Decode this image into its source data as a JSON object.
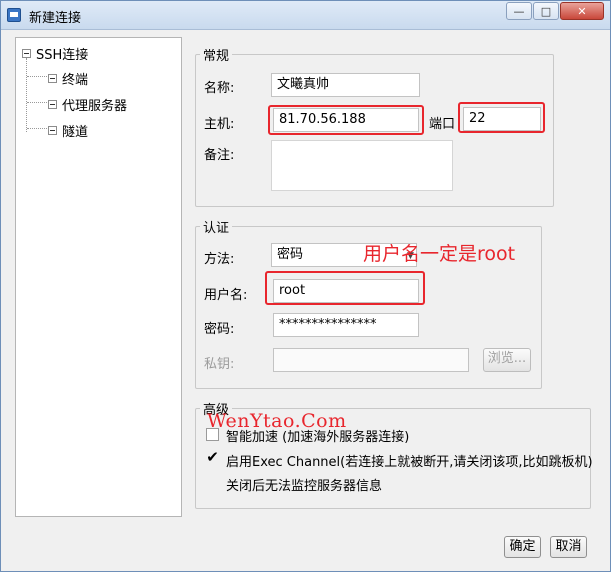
{
  "window": {
    "title": "新建连接",
    "minimize": "—",
    "maximize": "□",
    "close": "✕"
  },
  "tree": {
    "root": "SSH连接",
    "items": [
      {
        "label": "终端"
      },
      {
        "label": "代理服务器"
      },
      {
        "label": "隧道"
      }
    ]
  },
  "general": {
    "legend": "常规",
    "name_label": "名称:",
    "name_value": "文曦真帅",
    "host_label": "主机:",
    "host_value": "81.70.56.188",
    "port_label": "端口",
    "port_value": "22",
    "note_label": "备注:",
    "note_value": ""
  },
  "auth": {
    "legend": "认证",
    "method_label": "方法:",
    "method_value": "密码",
    "username_label": "用户名:",
    "username_value": "root",
    "password_label": "密码:",
    "password_value": "***************",
    "key_label": "私钥:",
    "key_value": "",
    "browse_label": "浏览..."
  },
  "annotation": "用户名一定是root",
  "advanced": {
    "legend": "高级",
    "watermark": "WenYtao.Com",
    "smart_accel": {
      "label": "智能加速 (加速海外服务器连接)",
      "checked": false
    },
    "exec_channel": {
      "label": "启用Exec Channel(若连接上就被断开,请关闭该项,比如跳板机)",
      "checked": true
    },
    "exec_note": "关闭后无法监控服务器信息"
  },
  "footer": {
    "ok": "确定",
    "cancel": "取消"
  },
  "colors": {
    "highlight": "#e8262d",
    "title_bar": "#c9daee"
  }
}
